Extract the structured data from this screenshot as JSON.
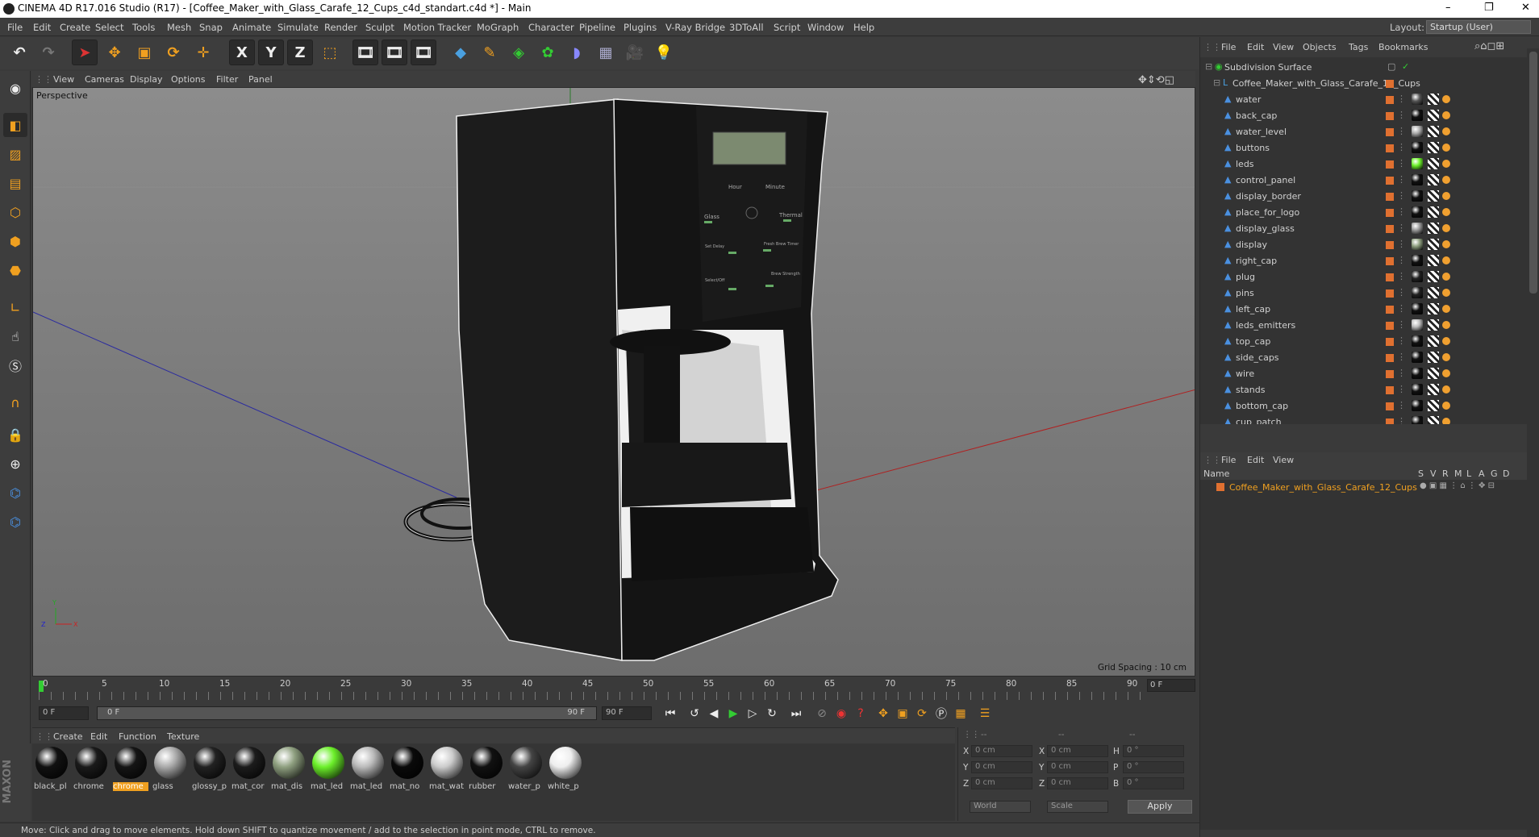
{
  "window": {
    "title": "CINEMA 4D R17.016 Studio (R17) - [Coffee_Maker_with_Glass_Carafe_12_Cups_c4d_standart.c4d *] - Main",
    "controls": [
      "–",
      "❐",
      "✕"
    ]
  },
  "menubar": {
    "items": [
      "File",
      "Edit",
      "Create",
      "Select",
      "Tools",
      "Mesh",
      "Snap",
      "Animate",
      "Simulate",
      "Render",
      "Sculpt",
      "Motion Tracker",
      "MoGraph",
      "Character",
      "Pipeline",
      "Plugins",
      "V-Ray Bridge",
      "3DToAll",
      "Script",
      "Window",
      "Help"
    ],
    "layout_label": "Layout:",
    "layout_value": "Startup (User)"
  },
  "toolbar": {
    "axis": [
      "X",
      "Y",
      "Z"
    ]
  },
  "viewport": {
    "menu": [
      "View",
      "Cameras",
      "Display",
      "Options",
      "Filter",
      "Panel"
    ],
    "label": "Perspective",
    "grid_spacing": "Grid Spacing : 10 cm",
    "panel": {
      "lcd_text": "",
      "hour": "Hour",
      "minute": "Minute",
      "glass": "Glass",
      "thermal": "Thermal",
      "set_delay": "Set Delay",
      "fresh_brew": "Fresh Brew Timer",
      "select_off": "Select/Off",
      "brew_strength": "Brew Strength"
    }
  },
  "timeline": {
    "ticks": [
      "0",
      "5",
      "10",
      "15",
      "20",
      "25",
      "30",
      "35",
      "40",
      "45",
      "50",
      "55",
      "60",
      "65",
      "70",
      "75",
      "80",
      "85",
      "90"
    ],
    "current_frame_right": "0 F",
    "start_field": "0 F",
    "range_start": "0 F",
    "range_end": "90 F",
    "end_field": "90 F"
  },
  "materials": {
    "menu": [
      "Create",
      "Edit",
      "Function",
      "Texture"
    ],
    "items": [
      {
        "label": "black_pl",
        "color": "#111"
      },
      {
        "label": "chrome",
        "color": "#1a1a1a"
      },
      {
        "label": "chrome",
        "color": "#151515",
        "selected": true
      },
      {
        "label": "glass",
        "color": "#aaa"
      },
      {
        "label": "glossy_p",
        "color": "#222"
      },
      {
        "label": "mat_cor",
        "color": "#1c1c1c"
      },
      {
        "label": "mat_dis",
        "color": "#8fa080"
      },
      {
        "label": "mat_led",
        "color": "#6cf02a"
      },
      {
        "label": "mat_led",
        "color": "#bbb"
      },
      {
        "label": "mat_no",
        "color": "#0a0a0a"
      },
      {
        "label": "mat_wat",
        "color": "#ccc"
      },
      {
        "label": "rubber",
        "color": "#111"
      },
      {
        "label": "water_p",
        "color": "#444"
      },
      {
        "label": "white_p",
        "color": "#eee"
      }
    ]
  },
  "coords": {
    "header": [
      "--",
      "--",
      "--"
    ],
    "rows": [
      {
        "a": "X",
        "av": "0 cm",
        "b": "X",
        "bv": "0 cm",
        "c": "H",
        "cv": "0 °"
      },
      {
        "a": "Y",
        "av": "0 cm",
        "b": "Y",
        "bv": "0 cm",
        "c": "P",
        "cv": "0 °"
      },
      {
        "a": "Z",
        "av": "0 cm",
        "b": "Z",
        "bv": "0 cm",
        "c": "B",
        "cv": "0 °"
      }
    ],
    "world": "World",
    "scale": "Scale",
    "apply": "Apply"
  },
  "status": "Move: Click and drag to move elements. Hold down SHIFT to quantize movement / add to the selection in point mode, CTRL to remove.",
  "objects": {
    "menu": [
      "File",
      "Edit",
      "View",
      "Objects",
      "Tags",
      "Bookmarks"
    ],
    "root": "Subdivision Surface",
    "group": "Coffee_Maker_with_Glass_Carafe_12_Cups",
    "children": [
      {
        "name": "water",
        "mat": "#555"
      },
      {
        "name": "back_cap",
        "mat": "#111"
      },
      {
        "name": "water_level",
        "mat": "#aaa"
      },
      {
        "name": "buttons",
        "mat": "#111"
      },
      {
        "name": "leds",
        "mat": "#6cf02a"
      },
      {
        "name": "control_panel",
        "mat": "#111"
      },
      {
        "name": "display_border",
        "mat": "#111"
      },
      {
        "name": "place_for_logo",
        "mat": "#111"
      },
      {
        "name": "display_glass",
        "mat": "#999"
      },
      {
        "name": "display",
        "mat": "#8fa080"
      },
      {
        "name": "right_cap",
        "mat": "#111"
      },
      {
        "name": "plug",
        "mat": "#222"
      },
      {
        "name": "pins",
        "mat": "#222"
      },
      {
        "name": "left_cap",
        "mat": "#111"
      },
      {
        "name": "leds_emitters",
        "mat": "#bbb"
      },
      {
        "name": "top_cap",
        "mat": "#111"
      },
      {
        "name": "side_caps",
        "mat": "#111"
      },
      {
        "name": "wire",
        "mat": "#111"
      },
      {
        "name": "stands",
        "mat": "#111"
      },
      {
        "name": "bottom_cap",
        "mat": "#111"
      },
      {
        "name": "cup_patch",
        "mat": "#111"
      }
    ]
  },
  "attributes": {
    "menu": [
      "File",
      "Edit",
      "View"
    ],
    "columns": [
      "Name",
      "S",
      "V",
      "R",
      "M",
      "L",
      "A",
      "G",
      "D"
    ],
    "row": "Coffee_Maker_with_Glass_Carafe_12_Cups"
  }
}
